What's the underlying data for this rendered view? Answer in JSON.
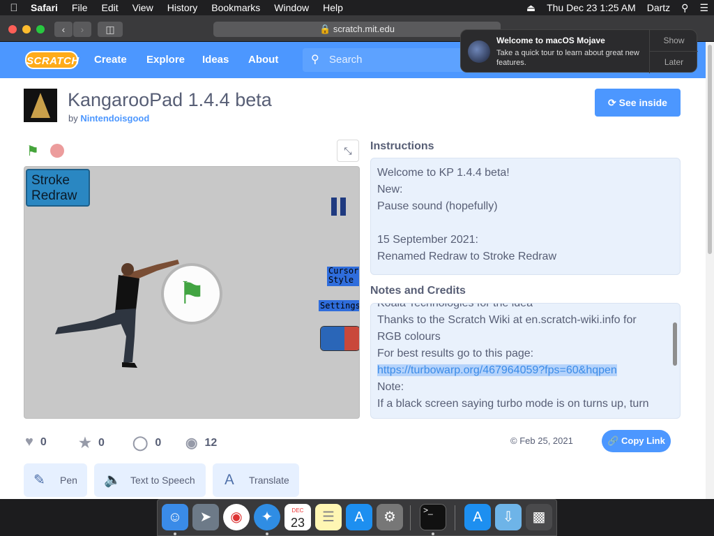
{
  "menubar": {
    "apple": "",
    "app": "Safari",
    "items": [
      "File",
      "Edit",
      "View",
      "History",
      "Bookmarks",
      "Window",
      "Help"
    ],
    "clock": "Thu Dec 23  1:25 AM",
    "user": "Dartz"
  },
  "browser": {
    "url": "scratch.mit.edu",
    "lock_icon": "lock-icon"
  },
  "notification": {
    "title": "Welcome to macOS Mojave",
    "text": "Take a quick tour to learn about great new features.",
    "show": "Show",
    "later": "Later"
  },
  "nav": {
    "logo": "SCRATCH",
    "links": [
      "Create",
      "Explore",
      "Ideas",
      "About"
    ],
    "search_placeholder": "Search"
  },
  "project": {
    "title": "KangarooPad 1.4.4 beta",
    "by": "by",
    "author": "Nintendoisgood",
    "see_inside": "See inside"
  },
  "stage": {
    "stroke_line1": "Stroke",
    "stroke_line2": "Redraw",
    "cursor_line1": "Cursor",
    "cursor_line2": "Style",
    "settings": "Settings"
  },
  "instructions": {
    "heading": "Instructions",
    "lines": [
      "Welcome to KP 1.4.4 beta!",
      "New:",
      "Pause sound (hopefully)",
      "",
      "15 September 2021:",
      "Renamed Redraw to Stroke Redraw"
    ]
  },
  "notes": {
    "heading": "Notes and Credits",
    "line1": "Koala Technologies for the idea",
    "line2": "Thanks to the Scratch Wiki at en.scratch-wiki.info for",
    "line3": "RGB colours",
    "line4": "For best results go to this page:",
    "link": "https://turbowarp.org/467964059?fps=60&hqpen",
    "line5": "Note:",
    "line6": "If a black screen saying turbo mode is on turns up, turn"
  },
  "stats": {
    "loves": "0",
    "favorites": "0",
    "remixes": "0",
    "views": "12",
    "shared_date": "Feb 25, 2021",
    "copy_link": "Copy Link"
  },
  "extensions": [
    "Pen",
    "Text to Speech",
    "Translate"
  ],
  "dock": {
    "calendar_month": "DEC",
    "calendar_day": "23"
  },
  "colors": {
    "scratch_blue": "#4c97ff",
    "orange": "#ffab19"
  }
}
